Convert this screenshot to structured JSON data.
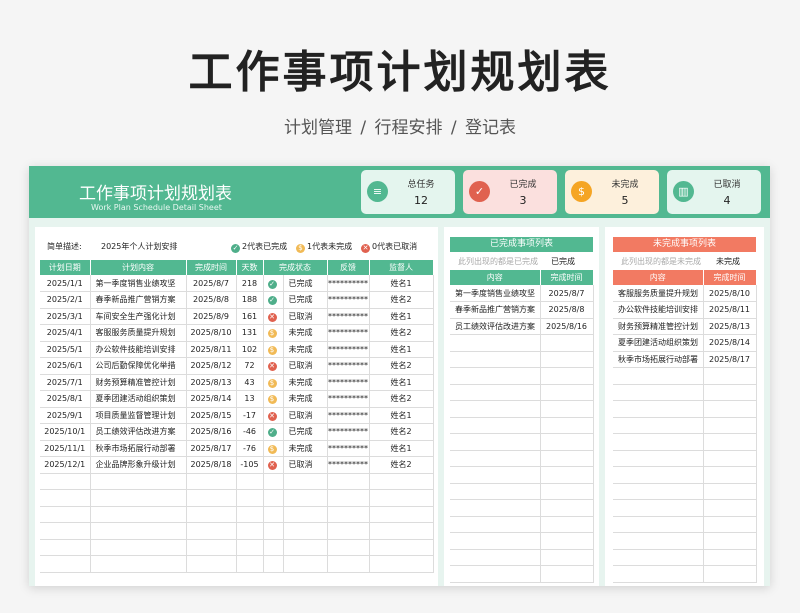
{
  "page": {
    "title": "工作事项计划规划表",
    "subtitle": "计划管理 / 行程安排 / 登记表"
  },
  "banner": {
    "title": "工作事项计划规划表",
    "subtitle": "Work Plan Schedule Detail Sheet"
  },
  "stats": [
    {
      "label": "总任务",
      "value": "12",
      "icon": "document-icon",
      "bg": "#e4f5ee",
      "icon_color": "#52b891"
    },
    {
      "label": "已完成",
      "value": "3",
      "icon": "check-icon",
      "bg": "#fbe0de",
      "icon_color": "#e0614f"
    },
    {
      "label": "未完成",
      "value": "5",
      "icon": "coin-icon",
      "bg": "#fdf0dc",
      "icon_color": "#f5a524"
    },
    {
      "label": "已取消",
      "value": "4",
      "icon": "chart-icon",
      "bg": "#e4f5ee",
      "icon_color": "#52b891"
    }
  ],
  "desc": {
    "label": "简单描述:",
    "value": "2025年个人计划安排"
  },
  "legend": [
    {
      "icon": "check",
      "text": "2代表已完成",
      "color": "#4fae8a"
    },
    {
      "icon": "coin",
      "text": "1代表未完成",
      "color": "#f1ba56"
    },
    {
      "icon": "cross",
      "text": "0代表已取消",
      "color": "#e0614f"
    }
  ],
  "main_table": {
    "headers": [
      "计划日期",
      "计划内容",
      "完成时间",
      "天数",
      "完成状态",
      "反馈",
      "监督人"
    ],
    "rows": [
      {
        "date": "2025/1/1",
        "content": "第一季度销售业绩攻坚",
        "done": "2025/8/7",
        "days": "218",
        "status_icon": "check",
        "status": "已完成",
        "feedback": "**********",
        "supervisor": "姓名1"
      },
      {
        "date": "2025/2/1",
        "content": "春季新品推广营销方案",
        "done": "2025/8/8",
        "days": "188",
        "status_icon": "check",
        "status": "已完成",
        "feedback": "**********",
        "supervisor": "姓名2"
      },
      {
        "date": "2025/3/1",
        "content": "车间安全生产强化计划",
        "done": "2025/8/9",
        "days": "161",
        "status_icon": "cross",
        "status": "已取消",
        "feedback": "**********",
        "supervisor": "姓名1"
      },
      {
        "date": "2025/4/1",
        "content": "客服服务质量提升规划",
        "done": "2025/8/10",
        "days": "131",
        "status_icon": "coin",
        "status": "未完成",
        "feedback": "**********",
        "supervisor": "姓名2"
      },
      {
        "date": "2025/5/1",
        "content": "办公软件技能培训安排",
        "done": "2025/8/11",
        "days": "102",
        "status_icon": "coin",
        "status": "未完成",
        "feedback": "**********",
        "supervisor": "姓名1"
      },
      {
        "date": "2025/6/1",
        "content": "公司后勤保障优化举措",
        "done": "2025/8/12",
        "days": "72",
        "status_icon": "cross",
        "status": "已取消",
        "feedback": "**********",
        "supervisor": "姓名2"
      },
      {
        "date": "2025/7/1",
        "content": "财务预算精准管控计划",
        "done": "2025/8/13",
        "days": "43",
        "status_icon": "coin",
        "status": "未完成",
        "feedback": "**********",
        "supervisor": "姓名1"
      },
      {
        "date": "2025/8/1",
        "content": "夏季团建活动组织策划",
        "done": "2025/8/14",
        "days": "13",
        "status_icon": "coin",
        "status": "未完成",
        "feedback": "**********",
        "supervisor": "姓名2"
      },
      {
        "date": "2025/9/1",
        "content": "项目质量监督管理计划",
        "done": "2025/8/15",
        "days": "-17",
        "status_icon": "cross",
        "status": "已取消",
        "feedback": "**********",
        "supervisor": "姓名1"
      },
      {
        "date": "2025/10/1",
        "content": "员工绩效评估改进方案",
        "done": "2025/8/16",
        "days": "-46",
        "status_icon": "check",
        "status": "已完成",
        "feedback": "**********",
        "supervisor": "姓名2"
      },
      {
        "date": "2025/11/1",
        "content": "秋季市场拓展行动部署",
        "done": "2025/8/17",
        "days": "-76",
        "status_icon": "coin",
        "status": "未完成",
        "feedback": "**********",
        "supervisor": "姓名1"
      },
      {
        "date": "2025/12/1",
        "content": "企业品牌形象升级计划",
        "done": "2025/8/18",
        "days": "-105",
        "status_icon": "cross",
        "status": "已取消",
        "feedback": "**********",
        "supervisor": "姓名2"
      }
    ]
  },
  "done_panel": {
    "title": "已完成事项列表",
    "note": "此列出现的都是已完成",
    "note_value": "已完成",
    "headers": [
      "内容",
      "完成时间"
    ],
    "rows": [
      {
        "content": "第一季度销售业绩攻坚",
        "time": "2025/8/7"
      },
      {
        "content": "春季新品推广营销方案",
        "time": "2025/8/8"
      },
      {
        "content": "员工绩效评估改进方案",
        "time": "2025/8/16"
      }
    ]
  },
  "undone_panel": {
    "title": "未完成事项列表",
    "note": "此列出现的都是未完成",
    "note_value": "未完成",
    "headers": [
      "内容",
      "完成时间"
    ],
    "rows": [
      {
        "content": "客服服务质量提升规划",
        "time": "2025/8/10"
      },
      {
        "content": "办公软件技能培训安排",
        "time": "2025/8/11"
      },
      {
        "content": "财务预算精准管控计划",
        "time": "2025/8/13"
      },
      {
        "content": "夏季团建活动组织策划",
        "time": "2025/8/14"
      },
      {
        "content": "秋季市场拓展行动部署",
        "time": "2025/8/17"
      }
    ]
  }
}
